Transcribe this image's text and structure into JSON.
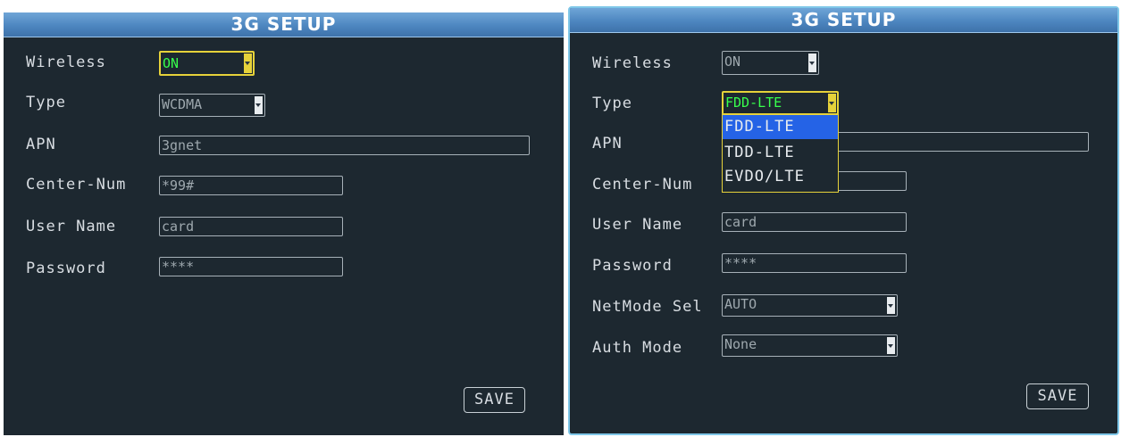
{
  "panels": [
    {
      "title": "3G SETUP",
      "wireless": {
        "label": "Wireless",
        "value": "ON"
      },
      "type": {
        "label": "Type",
        "value": "WCDMA"
      },
      "apn": {
        "label": "APN",
        "value": "3gnet"
      },
      "center_num": {
        "label": "Center-Num",
        "value": "*99#"
      },
      "user_name": {
        "label": "User Name",
        "value": "card"
      },
      "password": {
        "label": "Password",
        "value": "****"
      },
      "save_label": "SAVE"
    },
    {
      "title": "3G SETUP",
      "wireless": {
        "label": "Wireless",
        "value": "ON"
      },
      "type": {
        "label": "Type",
        "value": "FDD-LTE",
        "options": [
          "FDD-LTE",
          "TDD-LTE",
          "EVDO/LTE"
        ]
      },
      "apn": {
        "label": "APN",
        "value": ""
      },
      "center_num": {
        "label": "Center-Num",
        "value": ""
      },
      "user_name": {
        "label": "User Name",
        "value": "card"
      },
      "password": {
        "label": "Password",
        "value": "****"
      },
      "netmode": {
        "label": "NetMode Sel",
        "value": "AUTO"
      },
      "auth_mode": {
        "label": "Auth Mode",
        "value": "None"
      },
      "save_label": "SAVE"
    }
  ],
  "colors": {
    "background": "#1d2830",
    "titlebar": "#4d86c0",
    "active_text": "#38ff4c",
    "focus_border": "#e6d23a",
    "selected_option": "#2563e6"
  }
}
